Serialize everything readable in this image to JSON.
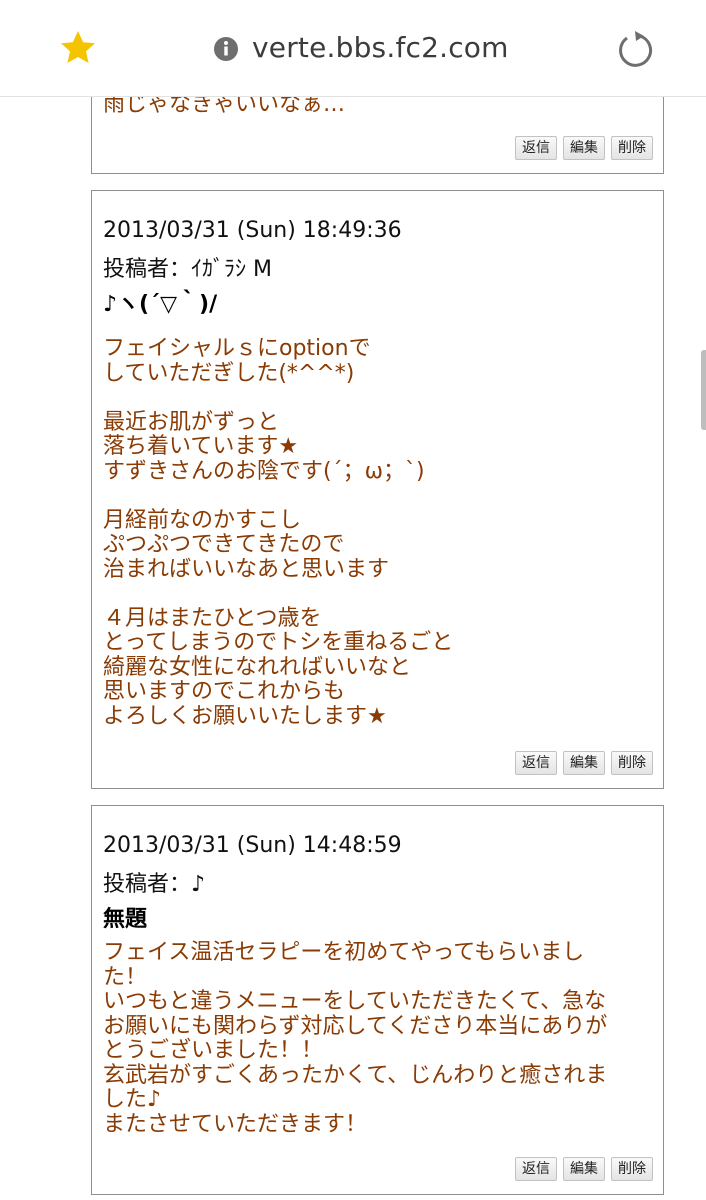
{
  "browser": {
    "url": "verte.bbs.fc2.com",
    "colors": {
      "star": "#f5c400",
      "icon_gray": "#6e6e6e"
    }
  },
  "colors": {
    "body_text": "#8a3b04",
    "border": "#8f8f8f"
  },
  "buttons": {
    "reply": "返信",
    "edit": "編集",
    "delete": "削除"
  },
  "posts": [
    {
      "body": "雨じゃなきゃいいなぁ…"
    },
    {
      "date": "2013/03/31 (Sun) 18:49:36",
      "author": "投稿者：ｲｶﾞﾗｼ M",
      "subject": "♪ヽ(´▽｀)/",
      "body": "フェイシャルｓにoptionで\nしていただぎした(*^^*)\n\n最近お肌がずっと\n落ち着いています★\nすずきさんのお陰です(´；ω；`)\n\n月経前なのかすこし\nぷつぷつできてきたので\n治まればいいなあと思います\n\n４月はまたひとつ歳を\nとってしまうのでトシを重ねるごと\n綺麗な女性になれればいいなと\n思いますのでこれからも\nよろしくお願いいたします★"
    },
    {
      "date": "2013/03/31 (Sun) 14:48:59",
      "author": "投稿者：♪",
      "subject": "無題",
      "body": "フェイス温活セラピーを初めてやってもらいまし\nた！\nいつもと違うメニューをしていただきたくて、急な\nお願いにも関わらず対応してくださり本当にありが\nとうございました！！\n玄武岩がすごくあったかくて、じんわりと癒されま\nした♪\nまたさせていただきます！"
    }
  ]
}
